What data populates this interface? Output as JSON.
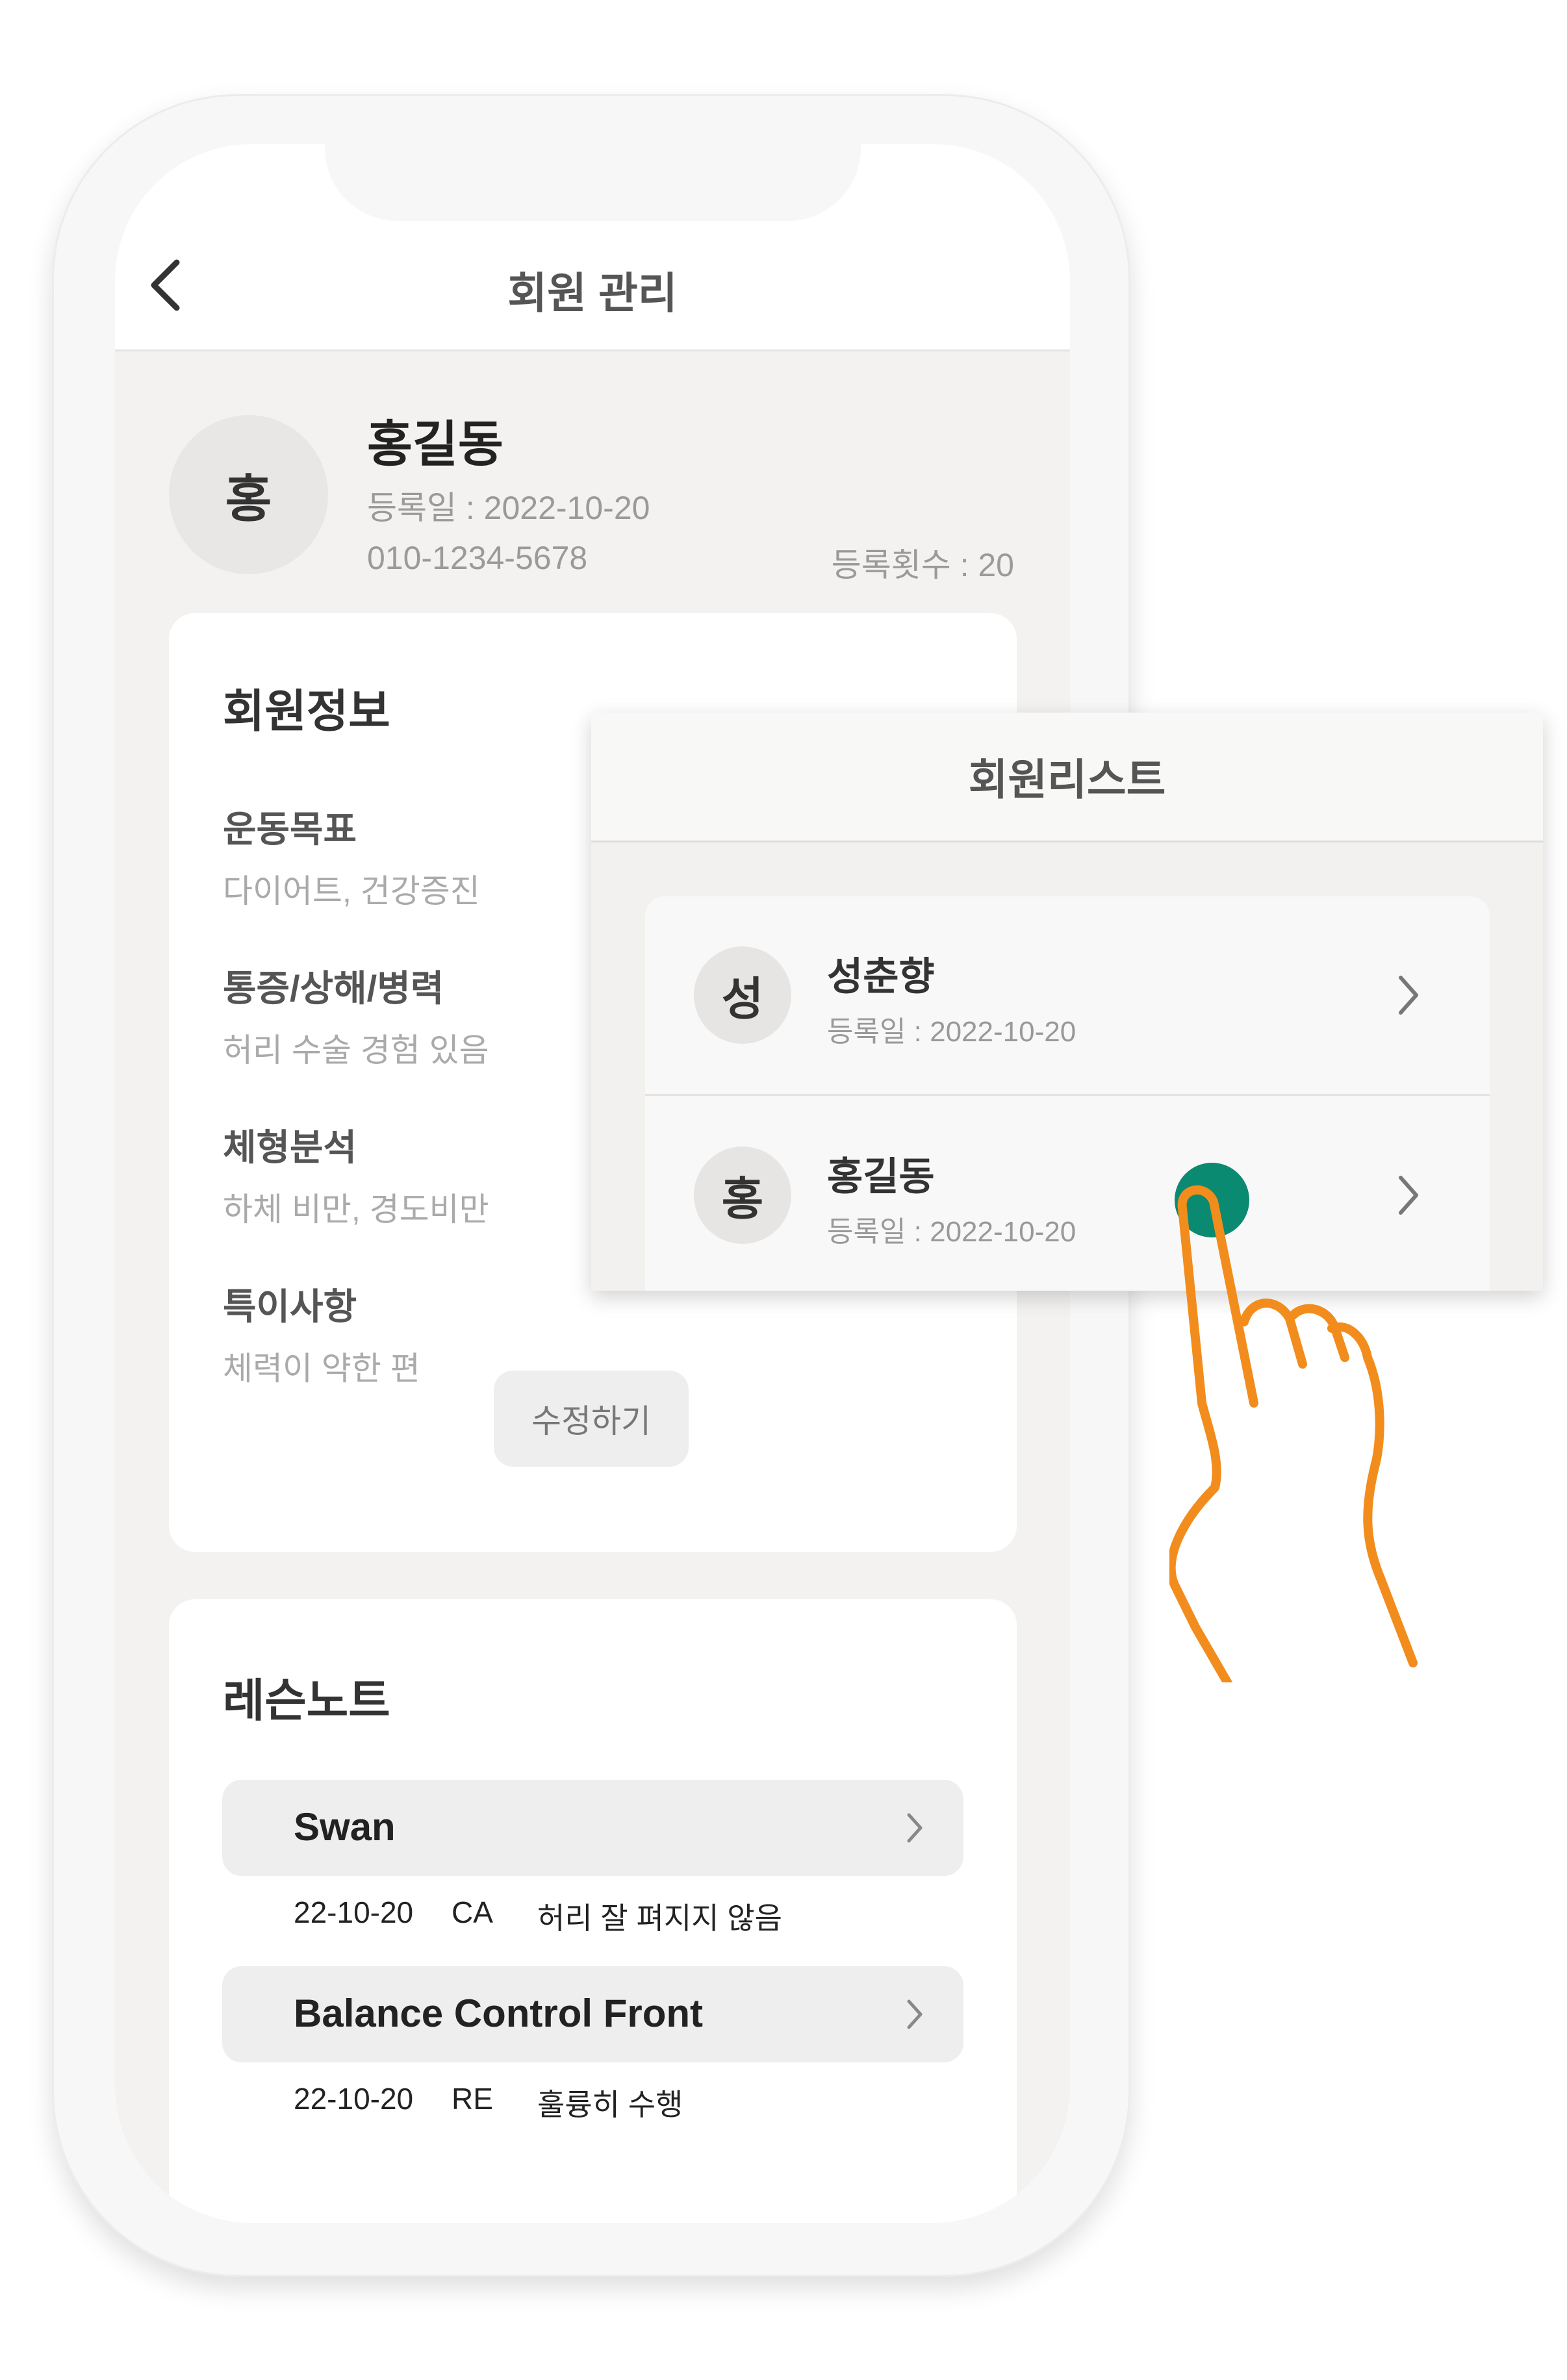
{
  "header": {
    "title": "회원 관리",
    "back_icon": "chevron-left-icon"
  },
  "member": {
    "initial": "홍",
    "name": "홍길동",
    "registered": "등록일 : 2022-10-20",
    "phone": "010-1234-5678",
    "count": "등록횟수 : 20"
  },
  "info": {
    "title": "회원정보",
    "fields": [
      {
        "label": "운동목표",
        "value": "다이어트, 건강증진"
      },
      {
        "label": "통증/상해/병력",
        "value": "허리 수술 경험 있음"
      },
      {
        "label": "체형분석",
        "value": "하체 비만, 경도비만"
      },
      {
        "label": "특이사항",
        "value": "체력이 약한 편"
      }
    ],
    "edit_label": "수정하기"
  },
  "notes": {
    "title": "레슨노트",
    "items": [
      {
        "name": "Swan",
        "date": "22-10-20",
        "type": "CA",
        "comment": "허리 잘 펴지지 않음"
      },
      {
        "name": "Balance Control Front",
        "date": "22-10-20",
        "type": "RE",
        "comment": "훌륭히 수행"
      }
    ]
  },
  "popup": {
    "title": "회원리스트",
    "members": [
      {
        "initial": "성",
        "name": "성춘향",
        "registered": "등록일 : 2022-10-20"
      },
      {
        "initial": "홍",
        "name": "홍길동",
        "registered": "등록일 : 2022-10-20"
      }
    ]
  },
  "colors": {
    "tap_indicator": "#0a8a70",
    "hand_outline": "#f28c1c",
    "screen_bg": "#f4f2f0"
  }
}
